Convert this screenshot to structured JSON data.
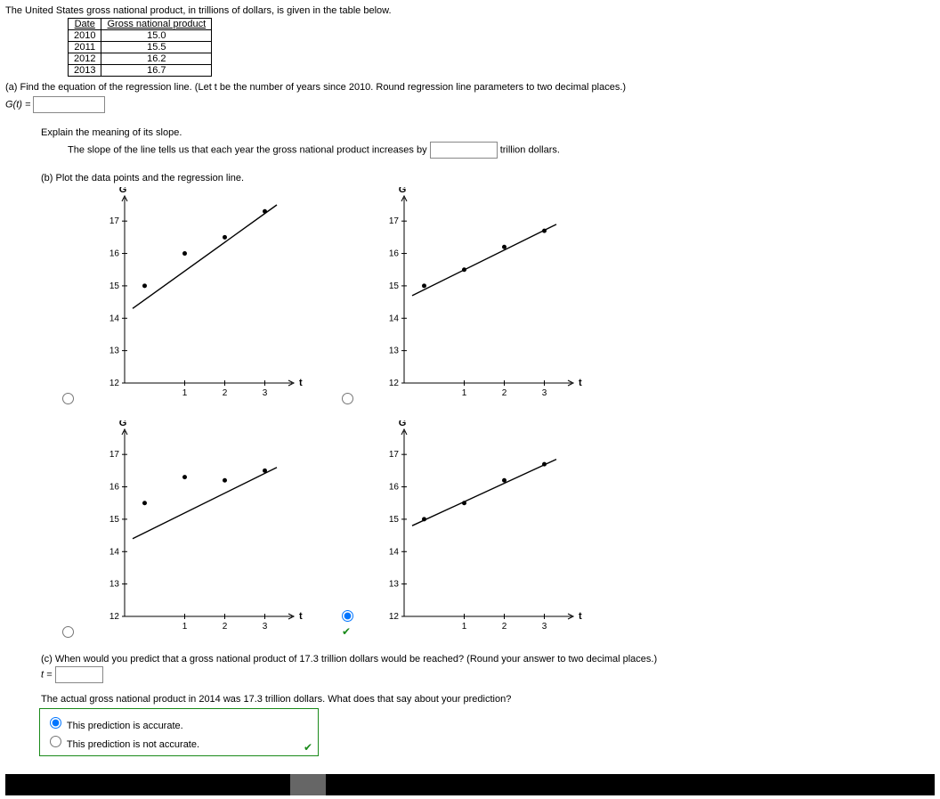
{
  "intro": "The United States gross national product, in trillions of dollars, is given in the table below.",
  "table": {
    "h1": "Date",
    "h2": "Gross national product",
    "rows": [
      {
        "d": "2010",
        "v": "15.0"
      },
      {
        "d": "2011",
        "v": "15.5"
      },
      {
        "d": "2012",
        "v": "16.2"
      },
      {
        "d": "2013",
        "v": "16.7"
      }
    ]
  },
  "partA": {
    "prompt": "(a) Find the equation of the regression line. (Let t be the number of years since 2010. Round regression line parameters to two decimal places.)",
    "lhs": "G(t) ="
  },
  "explain": {
    "head": "Explain the meaning of its slope.",
    "pre": "The slope of the line tells us that each year the gross national product increases by ",
    "post": " trillion dollars."
  },
  "partB": "(b) Plot the data points and the regression line.",
  "axis": {
    "y": "G",
    "x": "t"
  },
  "partC": {
    "prompt": "(c) When would you predict that a gross national product of 17.3 trillion dollars would be reached? (Round your answer to two decimal places.)",
    "lhs": "t ="
  },
  "actual": "The actual gross national product in 2014 was 17.3 trillion dollars. What does that say about your prediction?",
  "opt1": "This prediction is accurate.",
  "opt2": "This prediction is not accurate.",
  "chart_data": [
    {
      "type": "scatter+line",
      "x": [
        0,
        1,
        2,
        3
      ],
      "points": [
        15.0,
        16.0,
        16.5,
        17.3
      ],
      "line": {
        "x0": -0.3,
        "y0": 14.3,
        "x1": 3.3,
        "y1": 17.5
      },
      "ylim": [
        12,
        17.5
      ],
      "xlim": [
        -0.5,
        3.5
      ],
      "yticks": [
        12,
        13,
        14,
        15,
        16,
        17
      ],
      "xticks": [
        1,
        2,
        3
      ]
    },
    {
      "type": "scatter+line",
      "x": [
        0,
        1,
        2,
        3
      ],
      "points": [
        15.0,
        15.5,
        16.2,
        16.7
      ],
      "line": {
        "x0": -0.3,
        "y0": 14.7,
        "x1": 3.3,
        "y1": 16.9
      },
      "ylim": [
        12,
        17.5
      ],
      "xlim": [
        -0.5,
        3.5
      ],
      "yticks": [
        12,
        13,
        14,
        15,
        16,
        17
      ],
      "xticks": [
        1,
        2,
        3
      ]
    },
    {
      "type": "scatter+line",
      "x": [
        0,
        1,
        2,
        3
      ],
      "points": [
        15.5,
        16.3,
        16.2,
        16.5
      ],
      "line": {
        "x0": -0.3,
        "y0": 14.4,
        "x1": 3.3,
        "y1": 16.6
      },
      "ylim": [
        12,
        17.5
      ],
      "xlim": [
        -0.5,
        3.5
      ],
      "yticks": [
        12,
        13,
        14,
        15,
        16,
        17
      ],
      "xticks": [
        1,
        2,
        3
      ]
    },
    {
      "type": "scatter+line",
      "x": [
        0,
        1,
        2,
        3
      ],
      "points": [
        15.0,
        15.5,
        16.2,
        16.7
      ],
      "line": {
        "x0": -0.3,
        "y0": 14.8,
        "x1": 3.3,
        "y1": 16.85
      },
      "ylim": [
        12,
        17.5
      ],
      "xlim": [
        -0.5,
        3.5
      ],
      "yticks": [
        12,
        13,
        14,
        15,
        16,
        17
      ],
      "xticks": [
        1,
        2,
        3
      ]
    }
  ]
}
